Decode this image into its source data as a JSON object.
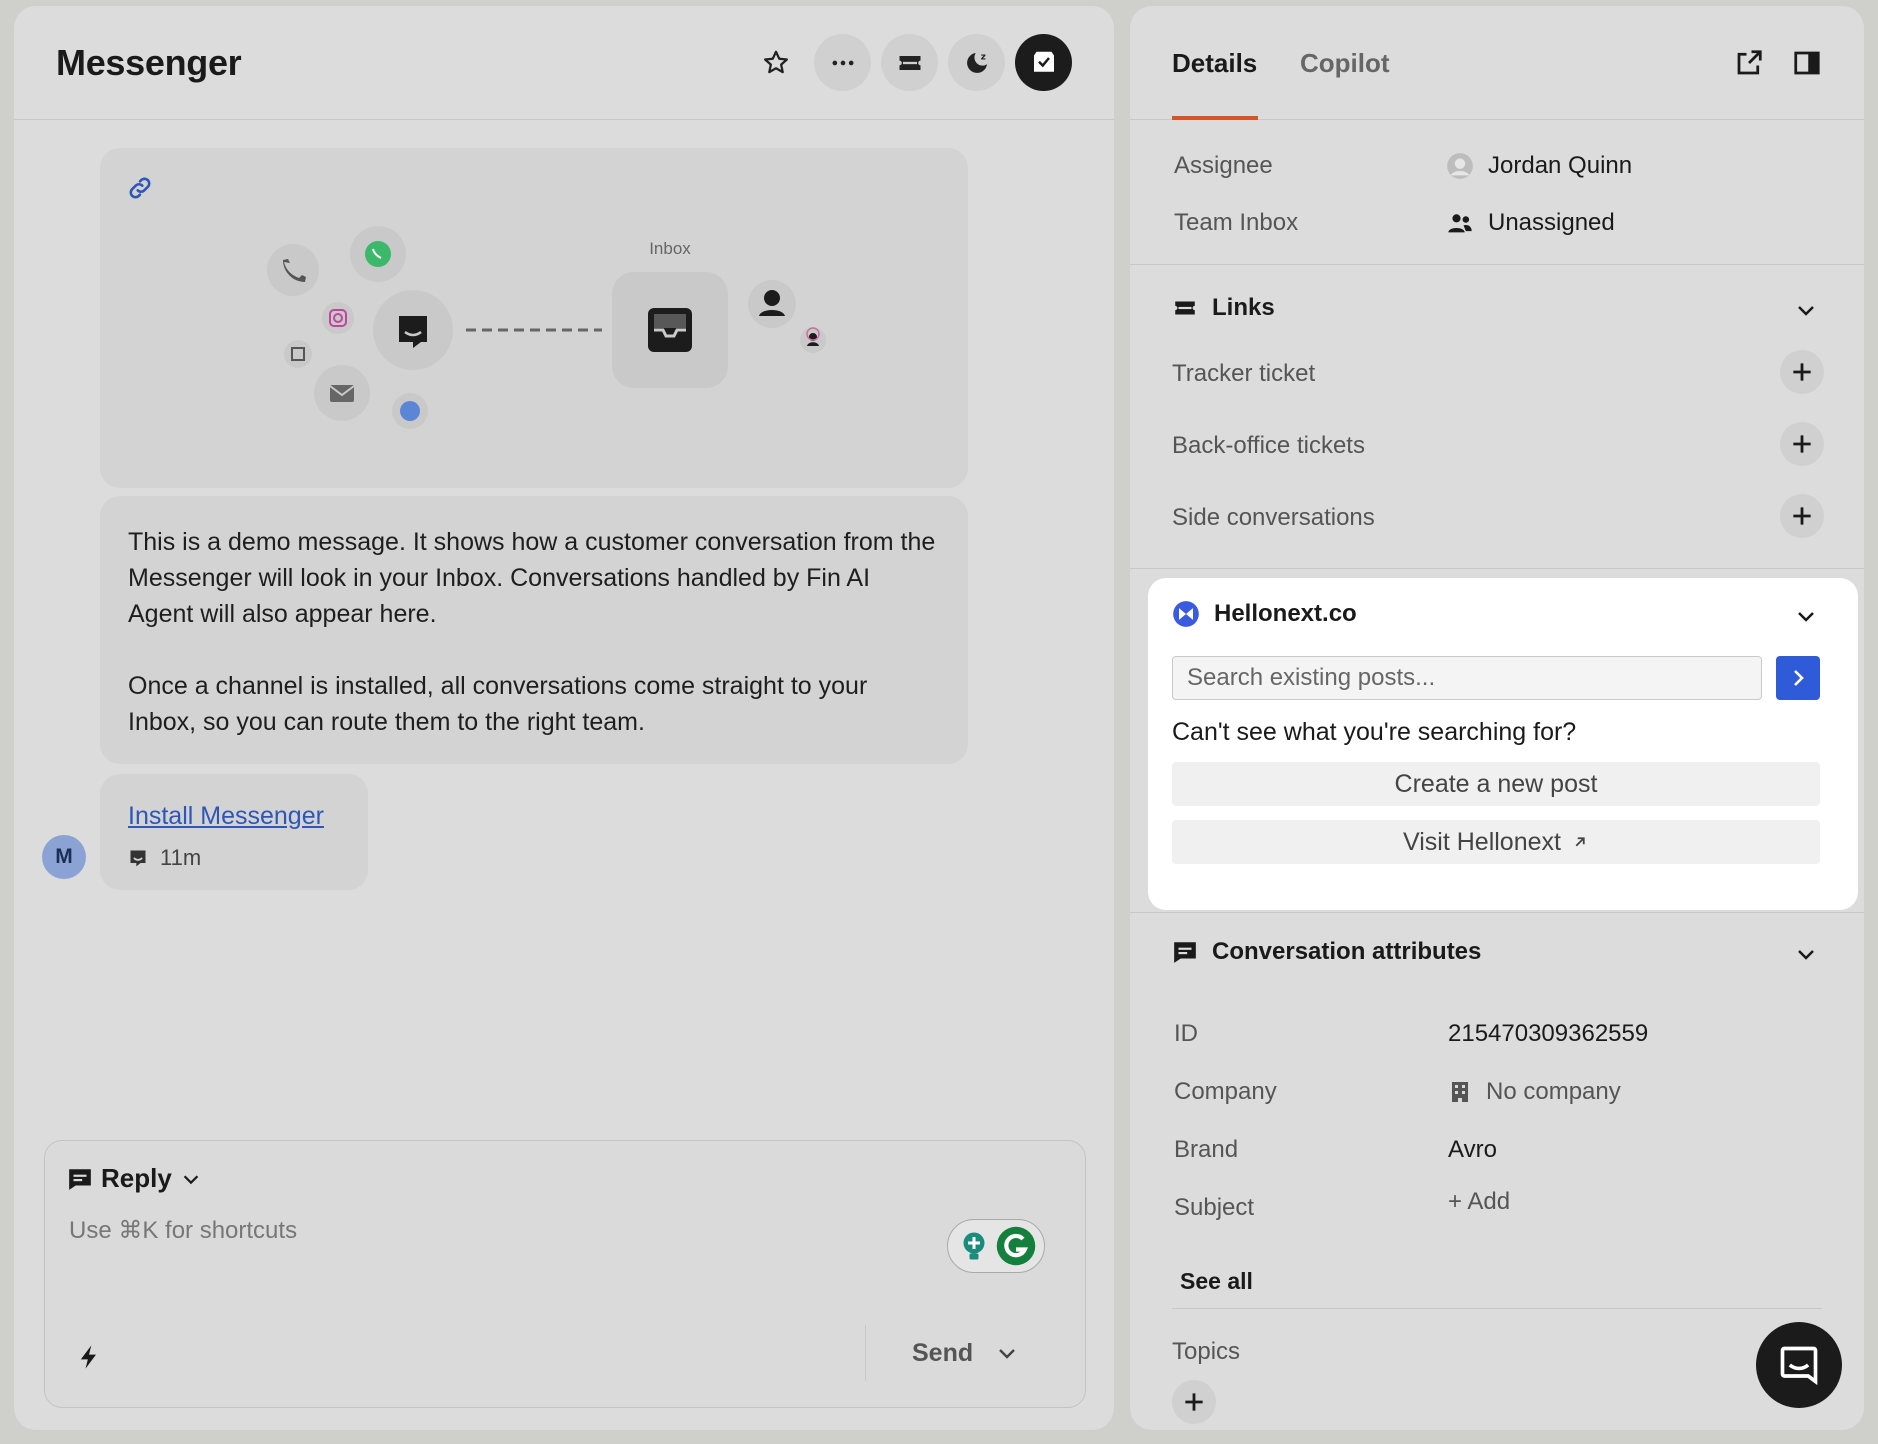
{
  "conversation": {
    "title": "Messenger",
    "header_icons": [
      "star-icon",
      "more-icon",
      "ticket-icon",
      "snooze-icon",
      "close-conversation-icon"
    ],
    "illustration": {
      "inbox_label": "Inbox"
    },
    "message_paragraphs": [
      "This is a demo message. It shows how a customer conversation from the Messenger will look in your Inbox. Conversations handled by Fin AI Agent will also appear here.",
      "Once a channel is installed, all conversations come straight to your Inbox, so you can route them to the right team."
    ],
    "install_link": "Install Messenger",
    "time_ago": "11m",
    "avatar_letter": "M"
  },
  "composer": {
    "mode": "Reply",
    "placeholder": "Use ⌘K for shortcuts",
    "send_label": "Send"
  },
  "details": {
    "tabs": [
      "Details",
      "Copilot"
    ],
    "assignee_label": "Assignee",
    "assignee_value": "Jordan Quinn",
    "team_inbox_label": "Team Inbox",
    "team_inbox_value": "Unassigned",
    "links": {
      "title": "Links",
      "items": [
        "Tracker ticket",
        "Back-office tickets",
        "Side conversations"
      ]
    },
    "hellonext": {
      "title": "Hellonext.co",
      "search_placeholder": "Search existing posts...",
      "question": "Can't see what you're searching for?",
      "create_label": "Create a new post",
      "visit_label": "Visit Hellonext",
      "accent": "#2f5bd8"
    },
    "attributes": {
      "title": "Conversation attributes",
      "id_label": "ID",
      "id_value": "215470309362559",
      "company_label": "Company",
      "company_value": "No company",
      "brand_label": "Brand",
      "brand_value": "Avro",
      "subject_label": "Subject",
      "subject_value": "+ Add",
      "see_all": "See all",
      "topics_label": "Topics"
    }
  },
  "colors": {
    "tab_underline": "#d4552a",
    "link": "#2e56b8",
    "panel_bg": "#dcdcdc"
  }
}
